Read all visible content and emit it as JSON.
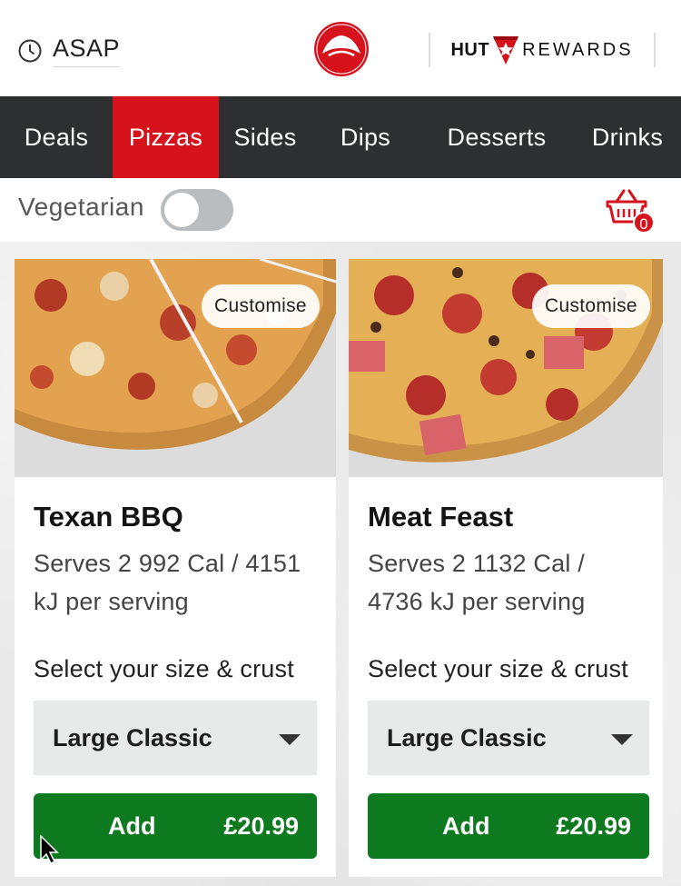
{
  "header": {
    "time_label": "ASAP",
    "rewards_left": "HUT",
    "rewards_right": "REWARDS"
  },
  "nav": {
    "tabs": [
      {
        "label": "Deals",
        "active": false
      },
      {
        "label": "Pizzas",
        "active": true
      },
      {
        "label": "Sides",
        "active": false
      },
      {
        "label": "Dips",
        "active": false
      },
      {
        "label": "Desserts",
        "active": false
      },
      {
        "label": "Drinks",
        "active": false
      }
    ]
  },
  "filter": {
    "vegetarian_label": "Vegetarian",
    "vegetarian_on": false,
    "basket_count": "0"
  },
  "products": [
    {
      "customise_label": "Customise",
      "name": "Texan BBQ",
      "description": "Serves 2 992 Cal / 4151 kJ per serving",
      "size_label": "Select your size & crust",
      "selected_size": "Large Classic",
      "add_label": "Add",
      "price": "£20.99"
    },
    {
      "customise_label": "Customise",
      "name": "Meat Feast",
      "description": "Serves 2 1132 Cal / 4736 kJ per serving",
      "size_label": "Select your size & crust",
      "selected_size": "Large Classic",
      "add_label": "Add",
      "price": "£20.99"
    }
  ],
  "colors": {
    "brand_red": "#d6121c",
    "nav_bg": "#2e2f30",
    "add_green": "#0d7a1f"
  }
}
